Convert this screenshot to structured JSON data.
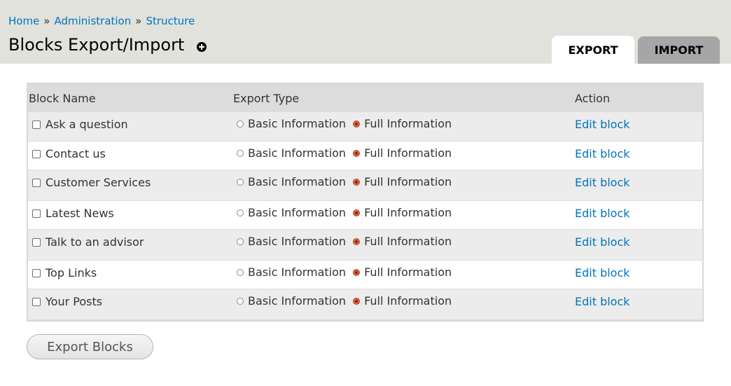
{
  "breadcrumb": {
    "items": [
      "Home",
      "Administration",
      "Structure"
    ],
    "separator": "»"
  },
  "page": {
    "title": "Blocks Export/Import",
    "shortcut_icon": "add-shortcut-icon"
  },
  "tabs": [
    {
      "label": "EXPORT",
      "active": true
    },
    {
      "label": "IMPORT",
      "active": false
    }
  ],
  "table": {
    "headers": {
      "name": "Block Name",
      "type": "Export Type",
      "action": "Action"
    },
    "option_labels": {
      "basic": "Basic Information",
      "full": "Full Information"
    },
    "rows": [
      {
        "name": "Ask a question",
        "checked": false,
        "selected": "full",
        "action": "Edit block"
      },
      {
        "name": "Contact us",
        "checked": false,
        "selected": "full",
        "action": "Edit block"
      },
      {
        "name": "Customer Services",
        "checked": false,
        "selected": "full",
        "action": "Edit block"
      },
      {
        "name": "Latest News",
        "checked": false,
        "selected": "full",
        "action": "Edit block"
      },
      {
        "name": "Talk to an advisor",
        "checked": false,
        "selected": "full",
        "action": "Edit block"
      },
      {
        "name": "Top Links",
        "checked": false,
        "selected": "full",
        "action": "Edit block"
      },
      {
        "name": "Your Posts",
        "checked": false,
        "selected": "full",
        "action": "Edit block"
      }
    ]
  },
  "submit": {
    "label": "Export Blocks"
  },
  "colors": {
    "link": "#0074bd",
    "header_bg": "#e1e2dc",
    "radio_selected": "#e4613b"
  }
}
